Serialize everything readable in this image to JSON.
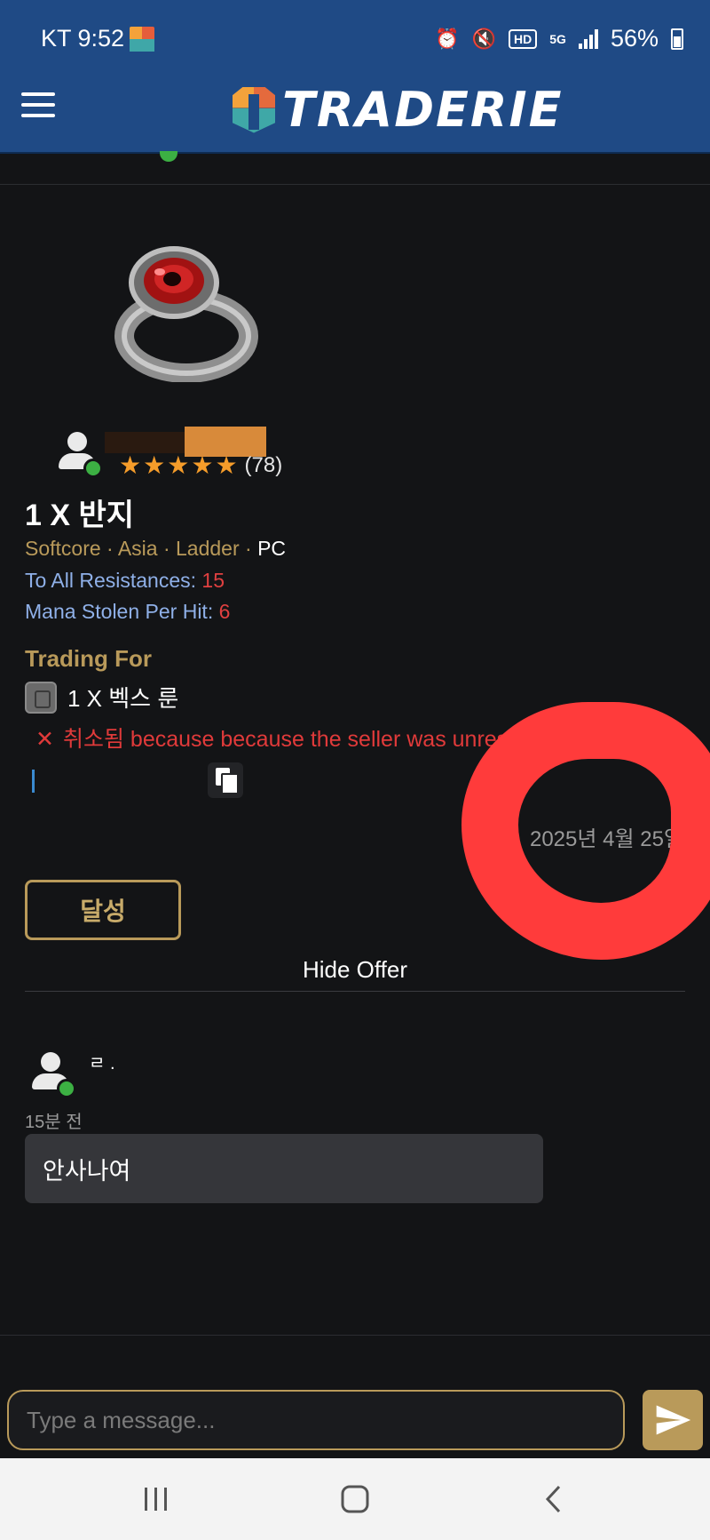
{
  "status_bar": {
    "carrier_time": "KT 9:52",
    "battery": "56%",
    "hd": "HD",
    "net": "5G"
  },
  "header": {
    "logo_text": "TRADERIE"
  },
  "listing": {
    "rating_count": "(78)",
    "stars": 5,
    "title": "1 X 반지",
    "meta_text": "Softcore · Asia · Ladder · ",
    "platform": "PC",
    "properties": [
      {
        "name": "To All Resistances: ",
        "value": "15"
      },
      {
        "name": "Mana Stolen Per Hit: ",
        "value": "6"
      }
    ],
    "trading_for_label": "Trading For",
    "trading_for_item": "1 X 벡스 룬",
    "cancel_x": "✕",
    "cancel_status": "취소됨",
    "cancel_reason": " because because the seller was unresp",
    "date": "2025년 4월 25일",
    "achieve_button": "달성",
    "hide_offer": "Hide Offer"
  },
  "chat": {
    "user_name": "ㄹ .",
    "time": "15분 전",
    "message": "안사나여",
    "input_placeholder": "Type a message..."
  },
  "colors": {
    "header_bg": "#1f4a85",
    "page_bg": "#131416",
    "accent_gold": "#b99a5a",
    "stat_blue": "#8fb0e8",
    "stat_red": "#e04040",
    "online_green": "#3cb043",
    "annotation_red": "#ff3b3b"
  }
}
